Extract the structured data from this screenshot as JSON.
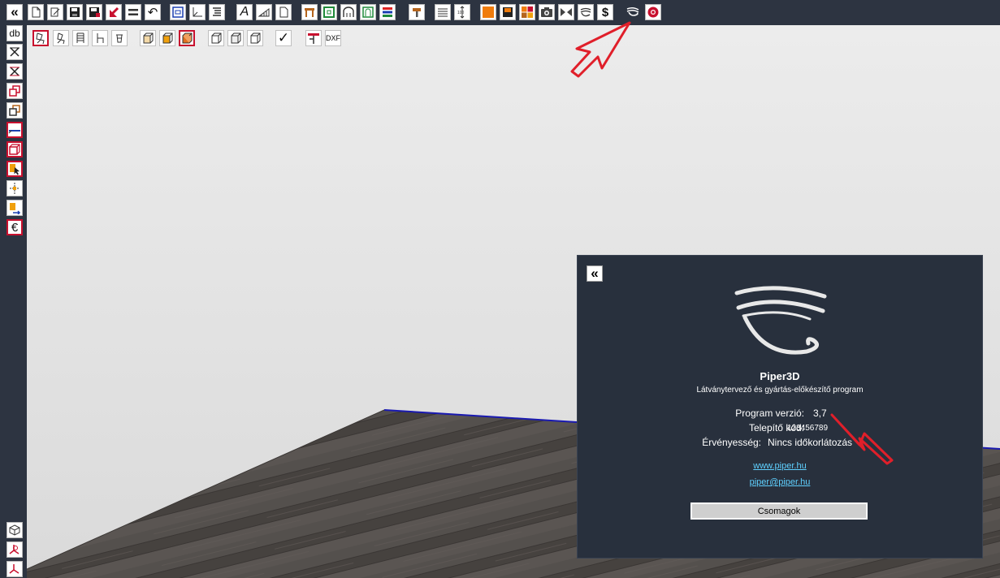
{
  "toolbar": {
    "buttons": [
      {
        "name": "collapse-button",
        "glyph": "«"
      },
      {
        "name": "new-file-button",
        "glyph": ""
      },
      {
        "name": "edit-file-button",
        "glyph": ""
      },
      {
        "name": "save-button",
        "glyph": ""
      },
      {
        "name": "save-as-button",
        "glyph": ""
      },
      {
        "name": "import-button",
        "glyph": ""
      },
      {
        "name": "align-button",
        "glyph": ""
      },
      {
        "name": "undo-button",
        "glyph": "↶"
      },
      {
        "name": "select-all-button",
        "glyph": ""
      },
      {
        "name": "measure-button",
        "glyph": ""
      },
      {
        "name": "list-button",
        "glyph": ""
      },
      {
        "name": "text-button",
        "glyph": "A"
      },
      {
        "name": "slope-button",
        "glyph": ""
      },
      {
        "name": "page-button",
        "glyph": ""
      },
      {
        "name": "table-button",
        "glyph": ""
      },
      {
        "name": "frame-button",
        "glyph": ""
      },
      {
        "name": "arch-button",
        "glyph": ""
      },
      {
        "name": "door-button",
        "glyph": ""
      },
      {
        "name": "color-bars-button",
        "glyph": ""
      },
      {
        "name": "hammer-button",
        "glyph": ""
      },
      {
        "name": "lines-button",
        "glyph": ""
      },
      {
        "name": "scale-100-button",
        "glyph": ""
      },
      {
        "name": "material-button",
        "glyph": ""
      },
      {
        "name": "render-button",
        "glyph": ""
      },
      {
        "name": "grid-button",
        "glyph": ""
      },
      {
        "name": "camera-button",
        "glyph": ""
      },
      {
        "name": "mirror-button",
        "glyph": ""
      },
      {
        "name": "wave-button",
        "glyph": ""
      },
      {
        "name": "price-button",
        "glyph": "$"
      },
      {
        "name": "about-button",
        "glyph": ""
      },
      {
        "name": "help-button",
        "glyph": ""
      }
    ]
  },
  "sidebar": {
    "db_label": "db"
  },
  "viewport_toolbar": {
    "dxf_label": "DXF",
    "check_glyph": "✓"
  },
  "about": {
    "back_glyph": "«",
    "title": "Piper3D",
    "subtitle": "Látványtervező és gyártás-előkészítő program",
    "version_label": "Program verzió:",
    "version_value": "3,7",
    "install_label": "Telepítő kód:",
    "install_value": "123456789",
    "validity_label": "Érvényesség:",
    "validity_value": "Nincs időkorlátozás",
    "website": "www.piper.hu",
    "email": "piper@piper.hu",
    "packages_button": "Csomagok"
  },
  "colors": {
    "chrome": "#2d3441",
    "panel": "#28303d",
    "link": "#5fd0ff",
    "accent_red": "#c8102e",
    "wall_edge": "#1a1ab0"
  }
}
